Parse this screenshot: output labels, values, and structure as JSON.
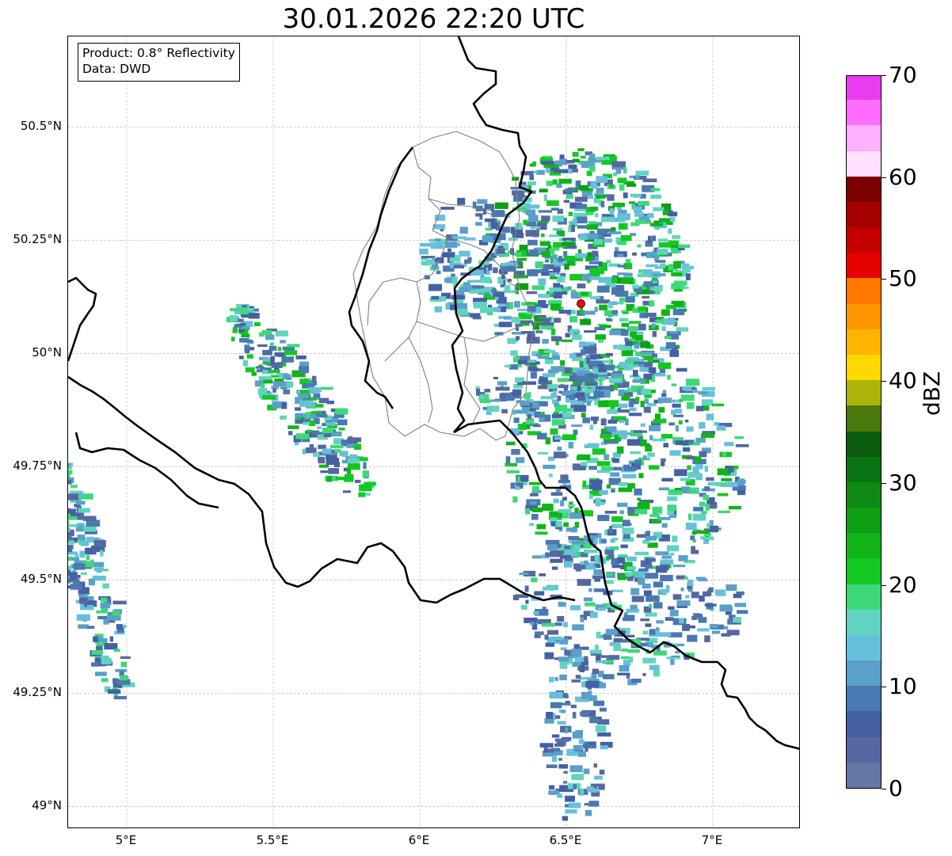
{
  "title": "30.01.2026 22:20 UTC",
  "info_box": {
    "product": "Product: 0.8° Reflectivity",
    "source": "Data: DWD"
  },
  "map": {
    "lon_range": [
      4.8,
      7.3
    ],
    "lat_range": [
      48.95,
      50.7
    ],
    "lon_ticks": [
      {
        "value": 5.0,
        "label": "5°E"
      },
      {
        "value": 5.5,
        "label": "5.5°E"
      },
      {
        "value": 6.0,
        "label": "6°E"
      },
      {
        "value": 6.5,
        "label": "6.5°E"
      },
      {
        "value": 7.0,
        "label": "7°E"
      }
    ],
    "lat_ticks": [
      {
        "value": 50.5,
        "label": "50.5°N"
      },
      {
        "value": 50.25,
        "label": "50.25°N"
      },
      {
        "value": 50.0,
        "label": "50°N"
      },
      {
        "value": 49.75,
        "label": "49.75°N"
      },
      {
        "value": 49.5,
        "label": "49.5°N"
      },
      {
        "value": 49.25,
        "label": "49.25°N"
      },
      {
        "value": 49.0,
        "label": "49°N"
      }
    ],
    "radar_site": {
      "lon": 6.55,
      "lat": 50.11,
      "color": "#ff0000"
    },
    "country_border_color": "#000000",
    "district_border_color": "#808080"
  },
  "colorbar": {
    "label": "dBZ",
    "min": 0,
    "max": 70,
    "tick_values": [
      0,
      10,
      20,
      30,
      40,
      50,
      60,
      70
    ],
    "tick_labels": [
      "0",
      "10",
      "20",
      "30",
      "40",
      "50",
      "60",
      "70"
    ],
    "colors": [
      "#6676a6",
      "#5568a0",
      "#4660a4",
      "#4a78b0",
      "#5aa0c8",
      "#66c0dc",
      "#60d4c0",
      "#3ed87a",
      "#14c822",
      "#10b418",
      "#0e9e14",
      "#0e8a14",
      "#0a7414",
      "#0a5c0e",
      "#48780e",
      "#acb40a",
      "#ffd800",
      "#ffb400",
      "#ff9600",
      "#ff7800",
      "#e60000",
      "#c40000",
      "#a40000",
      "#7c0000",
      "#ffe0ff",
      "#ffb0ff",
      "#ff6cff",
      "#e83cf0"
    ]
  }
}
